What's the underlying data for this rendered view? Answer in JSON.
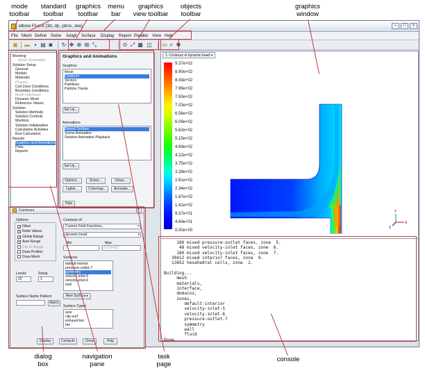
{
  "callouts": {
    "mode_toolbar": "mode\ntoolbar",
    "standard_toolbar": "standard\ntoolbar",
    "graphics_toolbar": "graphics\ntoolbar",
    "menu_bar": "menu\nbar",
    "graphics_view_toolbar": "graphics\nview toolbar",
    "objects_toolbar": "objects\ntoolbar",
    "graphics_window": "graphics\nwindow",
    "dialog_box": "dialog\nbox",
    "navigation_pane": "navigation\npane",
    "task_page": "task\npage",
    "console": "console"
  },
  "window": {
    "title": "elbow Fluent [3d, dp, pbns, ske]"
  },
  "menu": [
    "File",
    "Mesh",
    "Define",
    "Solve",
    "Adapt",
    "Surface",
    "Display",
    "Report",
    "Parallel",
    "View",
    "Help"
  ],
  "icons": [
    "fluent-logo-icon",
    "open-folder-icon",
    "save-icon",
    "print-icon",
    "rotate-icon",
    "pan-icon",
    "zoom-icon",
    "zoom-box-icon",
    "probe-icon",
    "fit-icon",
    "mouse-icon",
    "view-icon",
    "layout-icon",
    "select-icon",
    "objects-icon"
  ],
  "nav": {
    "items": [
      {
        "text": "Meshing",
        "style": "n"
      },
      {
        "text": "Mesh Generation",
        "style": "g"
      },
      {
        "text": "Solution Setup",
        "style": "n"
      },
      {
        "text": "General",
        "style": "i"
      },
      {
        "text": "Models",
        "style": "i"
      },
      {
        "text": "Materials",
        "style": "i"
      },
      {
        "text": "Phases",
        "style": "g"
      },
      {
        "text": "Cell Zone Conditions",
        "style": "i"
      },
      {
        "text": "Boundary Conditions",
        "style": "i"
      },
      {
        "text": "Mesh Interfaces",
        "style": "g"
      },
      {
        "text": "Dynamic Mesh",
        "style": "i"
      },
      {
        "text": "Reference Values",
        "style": "i"
      },
      {
        "text": "Solution",
        "style": "n"
      },
      {
        "text": "Solution Methods",
        "style": "i"
      },
      {
        "text": "Solution Controls",
        "style": "i"
      },
      {
        "text": "Monitors",
        "style": "i"
      },
      {
        "text": "Solution Initialization",
        "style": "i"
      },
      {
        "text": "Calculation Activities",
        "style": "i"
      },
      {
        "text": "Run Calculation",
        "style": "i"
      },
      {
        "text": "Results",
        "style": "n"
      },
      {
        "text": "Graphics and Animations",
        "style": "s"
      },
      {
        "text": "Plots",
        "style": "i"
      },
      {
        "text": "Reports",
        "style": "i"
      }
    ]
  },
  "task": {
    "title": "Graphics and Animations",
    "graphics_label": "Graphics",
    "graphics_items": [
      "Mesh",
      "Contours",
      "Vectors",
      "Pathlines",
      "Particle Tracks"
    ],
    "graphics_selected": 1,
    "setup1": "Set Up...",
    "animations_label": "Animations",
    "animation_items": [
      "Sweep Surface",
      "Scene Animation",
      "Solution Animation Playback"
    ],
    "animation_selected": 0,
    "setup2": "Set Up...",
    "options": "Options...",
    "scene": "Scene...",
    "views": "Views...",
    "lights": "Lights...",
    "colormap": "Colormap...",
    "annotate": "Annotate...",
    "help": "Help"
  },
  "graphics": {
    "tab": "1: Contours of dynamic-head",
    "colorbar": [
      "9.37e+02",
      "8.90e+02",
      "8.43e+02",
      "7.96e+02",
      "7.50e+02",
      "7.03e+02",
      "6.56e+02",
      "6.09e+02",
      "5.62e+02",
      "5.15e+02",
      "4.69e+02",
      "4.22e+02",
      "3.75e+02",
      "3.28e+02",
      "2.81e+02",
      "2.34e+02",
      "1.87e+02",
      "1.41e+02",
      "9.37e+01",
      "4.69e+01",
      "0.00e+00"
    ],
    "colors": [
      "#ff0000",
      "#ff3000",
      "#ff6000",
      "#ff9000",
      "#ffc000",
      "#fff000",
      "#d8ff00",
      "#a8ff00",
      "#78ff00",
      "#48ff00",
      "#18ff10",
      "#00ff48",
      "#00ff90",
      "#00ffd8",
      "#00e0ff",
      "#00a8ff",
      "#0070ff",
      "#0040ff",
      "#0018ff",
      "#0000f0",
      "#0000d8"
    ],
    "axes": {
      "x": "X",
      "y": "Y",
      "z": "Z"
    }
  },
  "console": {
    "text": "     180 mixed pressure-outlet faces, zone  5.\n      48 mixed velocity-inlet faces, zone  6.\n     180 mixed velocity-inlet faces, zone  7.\n   30412 mixed interior faces, zone  9.\n   13852 hexahedral cells, zone  2.\n\nBuilding...\n     mesh\n     materials,\n     interface,\n     domains,\n     zones,\n        default-interior\n        velocity-inlet-5\n        velocity-inlet-6\n        pressure-outlet-7\n        symmetry\n        wall\n        fluid\nDone."
  },
  "dialog": {
    "title": "Contours",
    "options_label": "Options",
    "options": [
      {
        "text": "Filled",
        "checked": true,
        "dim": false
      },
      {
        "text": "Node Values",
        "checked": true,
        "dim": false
      },
      {
        "text": "Global Range",
        "checked": true,
        "dim": false
      },
      {
        "text": "Auto Range",
        "checked": true,
        "dim": false
      },
      {
        "text": "Clip to Range",
        "checked": false,
        "dim": true
      },
      {
        "text": "Draw Profiles",
        "checked": false,
        "dim": false
      },
      {
        "text": "Draw Mesh",
        "checked": false,
        "dim": false
      }
    ],
    "contours_of_label": "Contours of",
    "contours_of": "Custom Field Functions...",
    "quantity": "dynamic-head",
    "min_label": "Min",
    "max_label": "Max",
    "min_value": "0",
    "max_value": "9.37e+02",
    "levels_label": "Levels",
    "setup_label": "Setup",
    "levels": "20",
    "setup": "1",
    "surfaces_label": "Surfaces",
    "surfaces": [
      "default-interior",
      "pressure-outlet-7",
      "symmetry",
      "velocity-inlet-5",
      "velocity-inlet-6",
      "wall"
    ],
    "surface_selected": 2,
    "new_surface": "New Surface ▸",
    "pattern_label": "Surface Name Pattern",
    "match": "Match",
    "surface_types_label": "Surface Types",
    "surface_types": [
      "axis",
      "clip-surf",
      "exhaust-fan",
      "fan"
    ],
    "display": "Display",
    "compute": "Compute",
    "close": "Close",
    "help": "Help"
  }
}
